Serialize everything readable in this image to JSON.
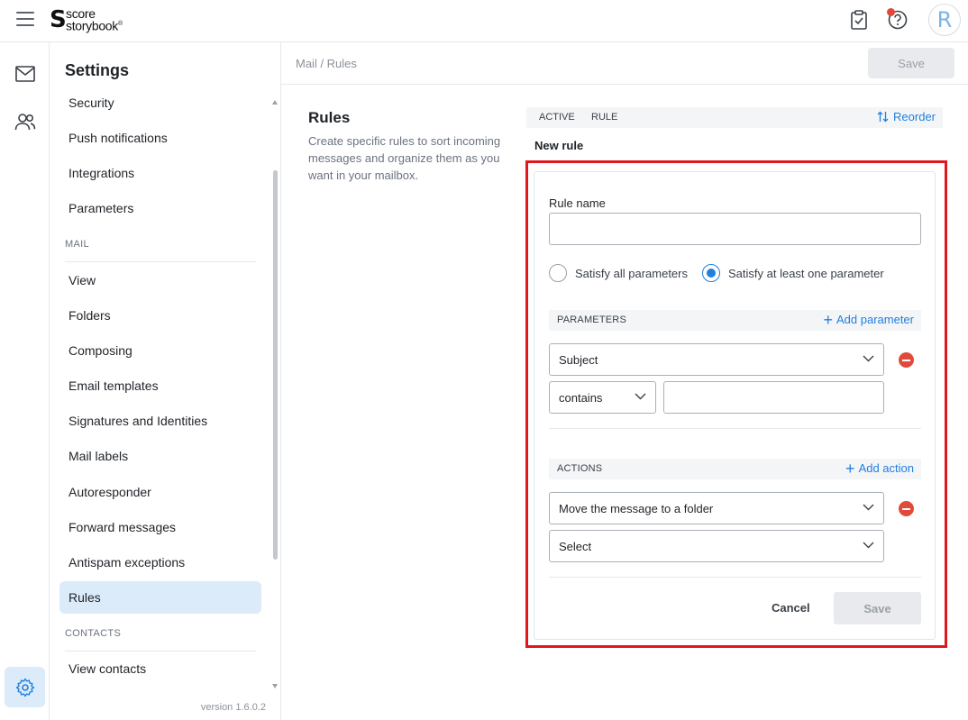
{
  "topbar": {
    "logo_line1": "score",
    "logo_line2": "storybook",
    "logo_reg": "®",
    "avatar_letter": "R"
  },
  "icons": {
    "menu": "hamburger-menu-icon",
    "tasks": "clipboard-check-icon",
    "help": "help-circle-icon",
    "mail": "envelope-icon",
    "contacts": "users-icon",
    "settings": "gear-icon"
  },
  "colors": {
    "accent": "#1f80e0",
    "active_bg": "#dcebfa",
    "danger": "#e04a3a",
    "highlight_border": "#e0171e"
  },
  "settings_nav": {
    "title": "Settings",
    "items_top": [
      "Security",
      "Push notifications",
      "Integrations",
      "Parameters"
    ],
    "mail_section": "MAIL",
    "mail_items": [
      "View",
      "Folders",
      "Composing",
      "Email templates",
      "Signatures and Identities",
      "Mail labels",
      "Autoresponder",
      "Forward messages",
      "Antispam exceptions",
      "Rules"
    ],
    "active_item": "Rules",
    "contacts_section": "CONTACTS",
    "contacts_items": [
      "View contacts"
    ],
    "version": "version 1.6.0.2"
  },
  "main": {
    "breadcrumb": "Mail / Rules",
    "save_label": "Save",
    "rules_title": "Rules",
    "rules_desc": "Create specific rules to sort incoming messages and organize them as you want in your mailbox.",
    "table_head": {
      "active": "ACTIVE",
      "rule": "RULE",
      "reorder": "Reorder"
    },
    "new_rule_label": "New rule"
  },
  "form": {
    "rule_name_label": "Rule name",
    "rule_name_value": "",
    "radio_all": "Satisfy all parameters",
    "radio_any": "Satisfy at least one parameter",
    "radio_selected": "any",
    "parameters_label": "PARAMETERS",
    "add_parameter": "Add parameter",
    "param_field": "Subject",
    "param_operator": "contains",
    "param_value": "",
    "actions_label": "ACTIONS",
    "add_action": "Add action",
    "action_type": "Move the message to a folder",
    "action_target": "Select",
    "cancel_label": "Cancel",
    "save_label": "Save"
  }
}
